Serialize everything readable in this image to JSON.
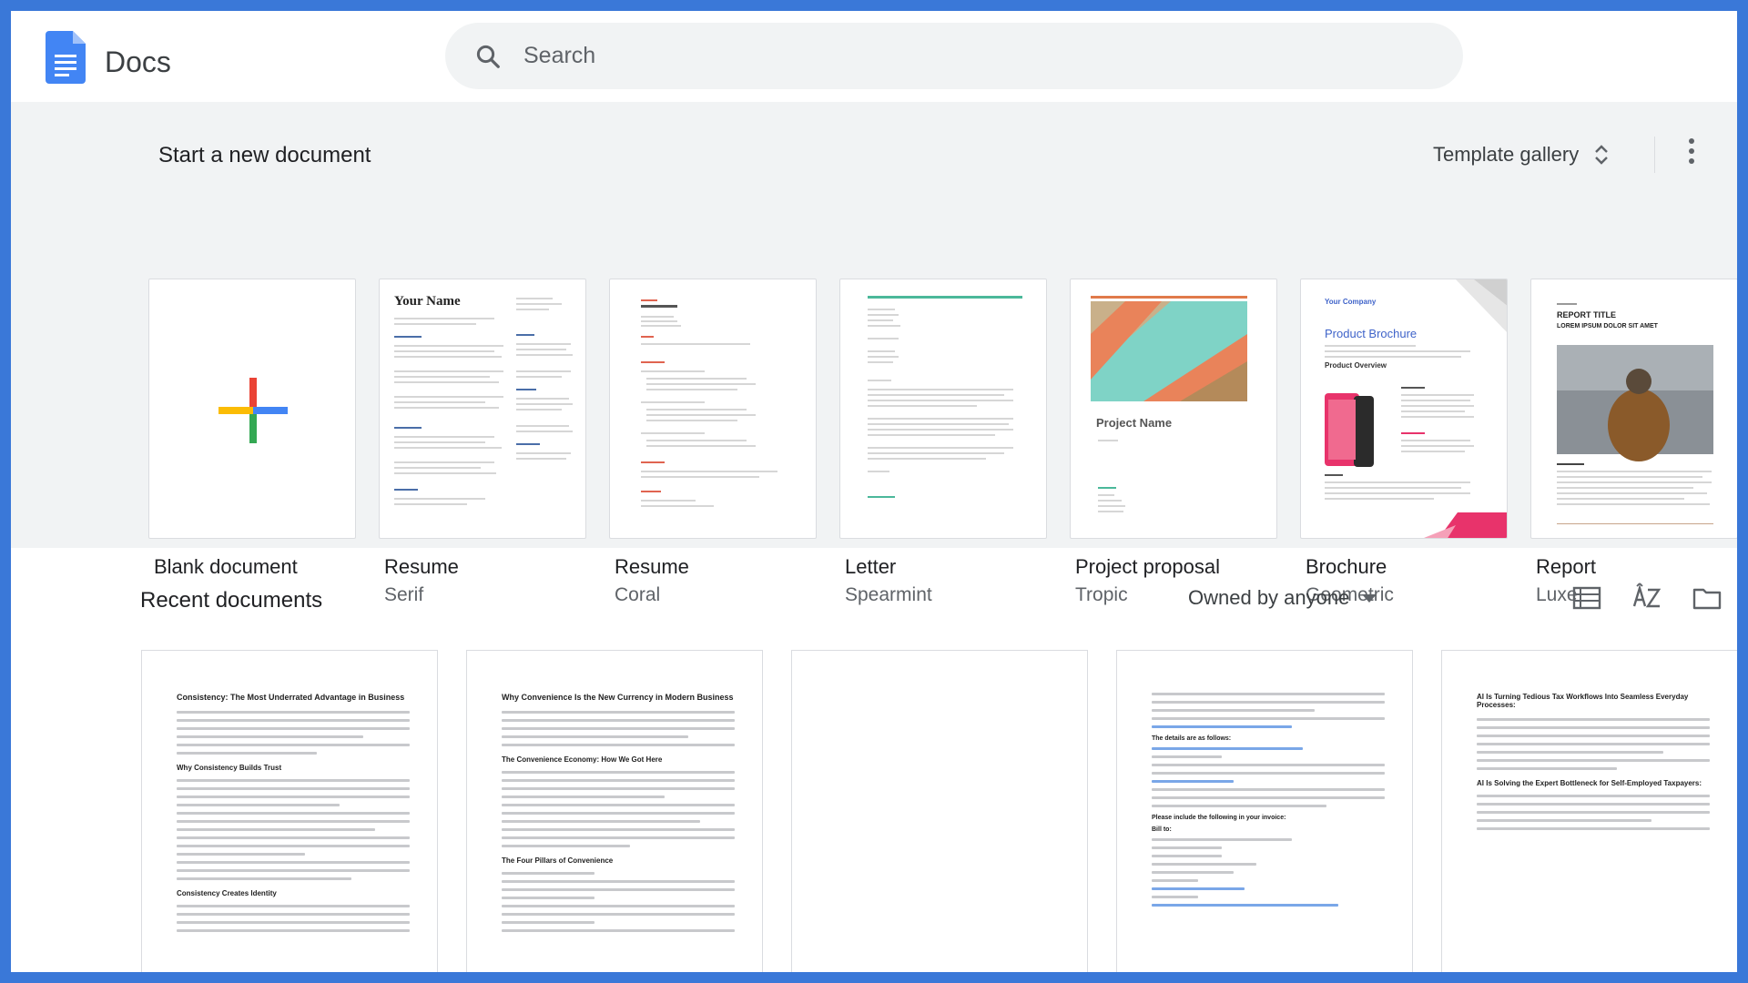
{
  "app": {
    "name": "Docs"
  },
  "search": {
    "placeholder": "Search"
  },
  "new_document": {
    "title": "Start a new document",
    "template_gallery_label": "Template gallery",
    "templates": [
      {
        "name": "Blank document",
        "subtitle": ""
      },
      {
        "name": "Resume",
        "subtitle": "Serif",
        "preview_heading": "Your Name"
      },
      {
        "name": "Resume",
        "subtitle": "Coral"
      },
      {
        "name": "Letter",
        "subtitle": "Spearmint"
      },
      {
        "name": "Project proposal",
        "subtitle": "Tropic",
        "preview_heading": "Project Name"
      },
      {
        "name": "Brochure",
        "subtitle": "Geometric",
        "preview_company": "Your Company",
        "preview_heading": "Product Brochure",
        "preview_section": "Product Overview"
      },
      {
        "name": "Report",
        "subtitle": "Luxe",
        "preview_heading": "REPORT TITLE",
        "preview_subheading": "LOREM IPSUM DOLOR SIT AMET"
      }
    ]
  },
  "recent": {
    "title": "Recent documents",
    "owner_filter": "Owned by anyone",
    "documents": [
      {
        "title": "Consistency: The Most Underrated Advantage in Business",
        "h2": "Why Consistency Builds Trust",
        "h3": "Consistency Creates Identity"
      },
      {
        "title": "Why Convenience Is the New Currency in Modern Business",
        "h2": "The Convenience Economy: How We Got Here",
        "h3": "The Four Pillars of Convenience"
      },
      {
        "title": "",
        "h2": "",
        "h3": ""
      },
      {
        "title": "The details are as follows:",
        "h2": "Please include the following in your invoice:",
        "h3": "Bill to:"
      },
      {
        "title": "AI Is Turning Tedious Tax Workflows Into Seamless Everyday Processes:",
        "h2": "AI Is Solving the Expert Bottleneck for Self-Employed Taxpayers:",
        "h3": ""
      }
    ]
  },
  "colors": {
    "frame": "#3a78d8",
    "docs_blue": "#4285f4",
    "section_bg": "#f1f3f4",
    "coral": "#e06450",
    "spearmint": "#4bb89a",
    "brochure_pink": "#e8336b"
  }
}
